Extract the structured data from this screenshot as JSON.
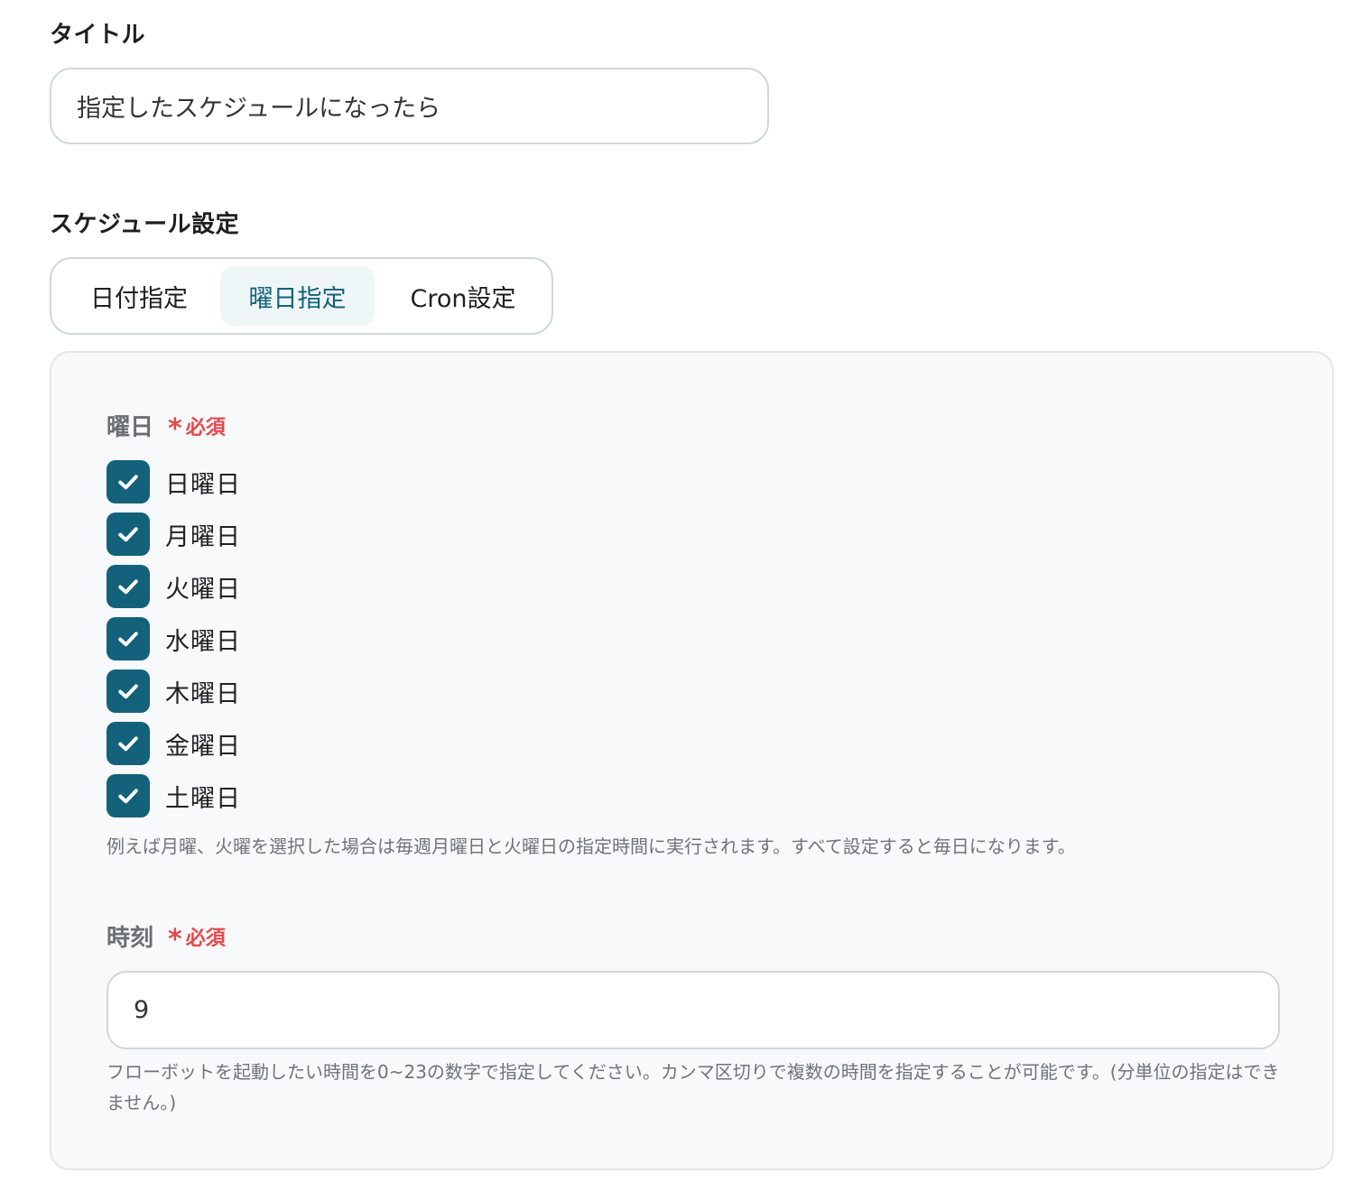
{
  "title_field": {
    "label": "タイトル",
    "value": "指定したスケジュールになったら"
  },
  "schedule": {
    "label": "スケジュール設定",
    "tabs": [
      {
        "label": "日付指定",
        "selected": false
      },
      {
        "label": "曜日指定",
        "selected": true
      },
      {
        "label": "Cron設定",
        "selected": false
      }
    ],
    "weekday": {
      "label": "曜日",
      "required_mark": "*",
      "required_text": "必須",
      "options": [
        {
          "label": "日曜日",
          "checked": true
        },
        {
          "label": "月曜日",
          "checked": true
        },
        {
          "label": "火曜日",
          "checked": true
        },
        {
          "label": "水曜日",
          "checked": true
        },
        {
          "label": "木曜日",
          "checked": true
        },
        {
          "label": "金曜日",
          "checked": true
        },
        {
          "label": "土曜日",
          "checked": true
        }
      ],
      "hint": "例えば月曜、火曜を選択した場合は毎週月曜日と火曜日の指定時間に実行されます。すべて設定すると毎日になります。"
    },
    "time": {
      "label": "時刻",
      "required_mark": "*",
      "required_text": "必須",
      "value": "9",
      "hint": "フローボットを起動したい時間を0~23の数字で指定してください。カンマ区切りで複数の時間を指定することが可能です。(分単位の指定はできません。)"
    }
  },
  "colors": {
    "accent": "#13617a",
    "required": "#e5484d",
    "selected_tab_bg": "#eef6f7"
  },
  "icons": {
    "checkbox": "check-icon"
  }
}
